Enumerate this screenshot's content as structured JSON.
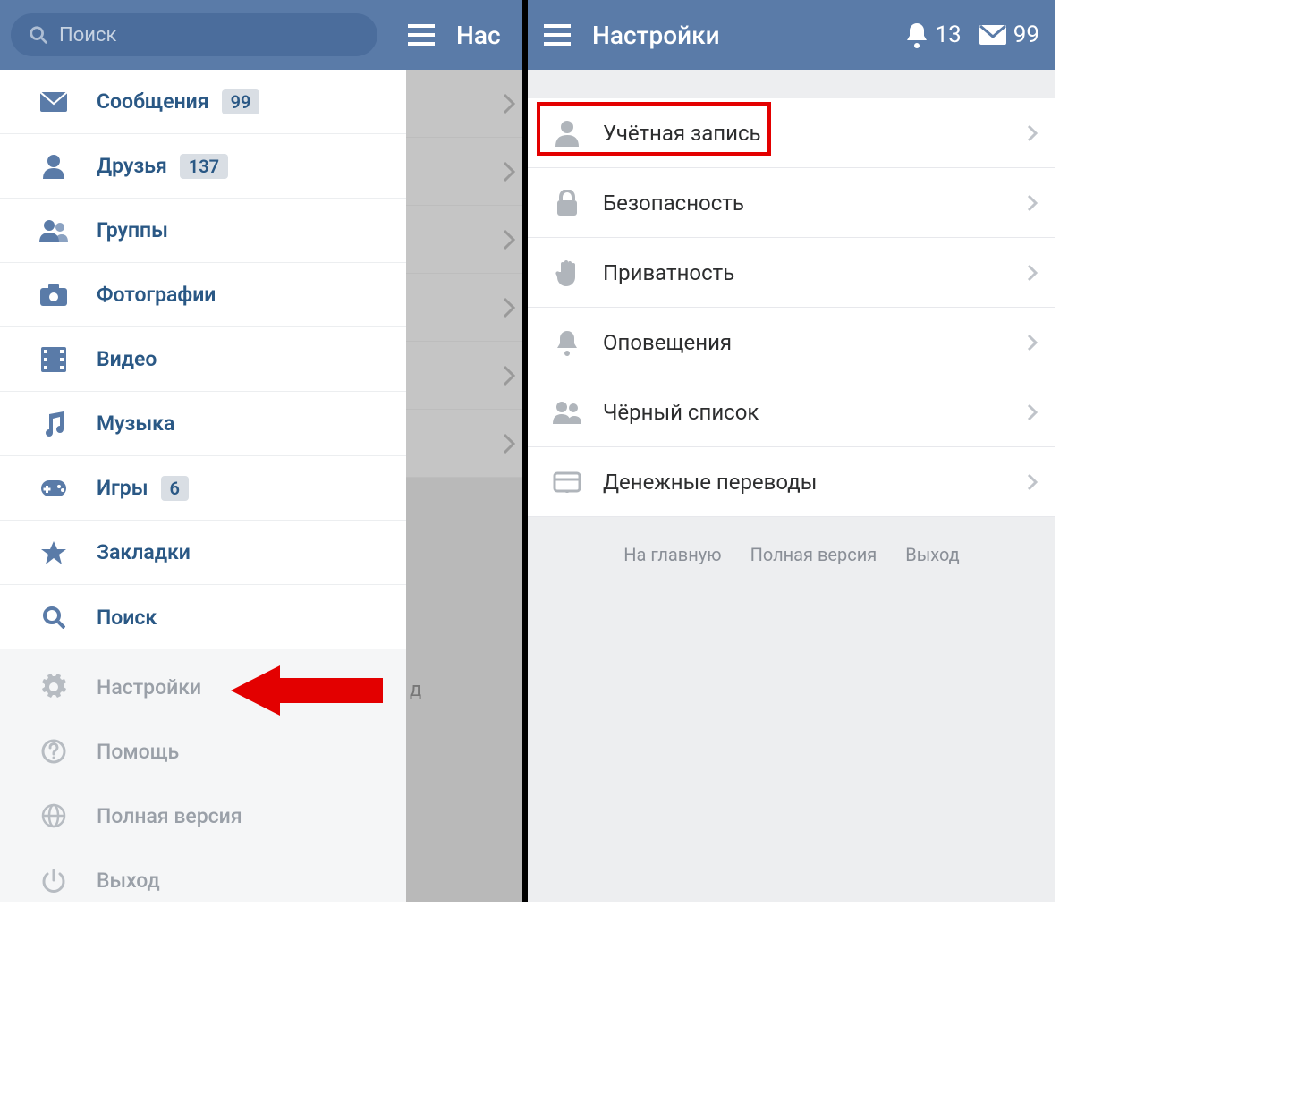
{
  "left": {
    "search_placeholder": "Поиск",
    "title_fragment": "Нас",
    "menu": [
      {
        "key": "messages",
        "label": "Сообщения",
        "badge": "99"
      },
      {
        "key": "friends",
        "label": "Друзья",
        "badge": "137"
      },
      {
        "key": "groups",
        "label": "Группы"
      },
      {
        "key": "photos",
        "label": "Фотографии"
      },
      {
        "key": "video",
        "label": "Видео"
      },
      {
        "key": "music",
        "label": "Музыка"
      },
      {
        "key": "games",
        "label": "Игры",
        "badge": "6"
      },
      {
        "key": "bookmarks",
        "label": "Закладки"
      },
      {
        "key": "search",
        "label": "Поиск"
      }
    ],
    "gray_menu": [
      {
        "key": "settings",
        "label": "Настройки"
      },
      {
        "key": "help",
        "label": "Помощь"
      },
      {
        "key": "full",
        "label": "Полная версия"
      },
      {
        "key": "logout",
        "label": "Выход"
      }
    ],
    "overlay_fragment": "д"
  },
  "right": {
    "title": "Настройки",
    "notif_count": "13",
    "msg_count": "99",
    "settings": [
      {
        "key": "account",
        "label": "Учётная запись",
        "highlight": true
      },
      {
        "key": "security",
        "label": "Безопасность"
      },
      {
        "key": "privacy",
        "label": "Приватность"
      },
      {
        "key": "notifications",
        "label": "Оповещения"
      },
      {
        "key": "blacklist",
        "label": "Чёрный список"
      },
      {
        "key": "payments",
        "label": "Денежные переводы"
      }
    ],
    "footer": {
      "home": "На главную",
      "full": "Полная версия",
      "logout": "Выход"
    }
  }
}
